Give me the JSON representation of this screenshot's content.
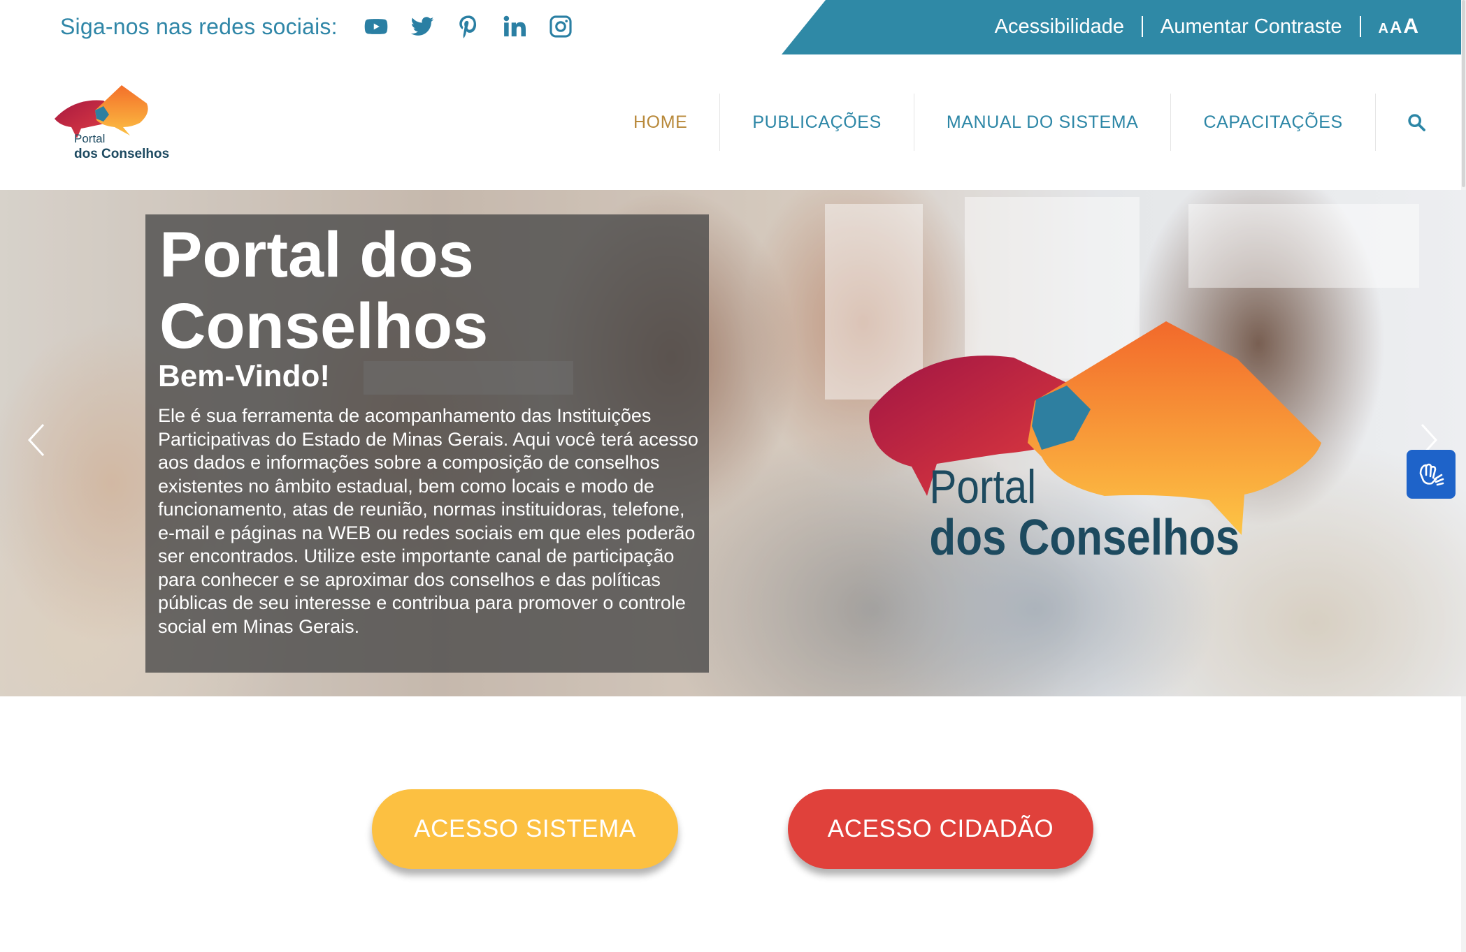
{
  "topbar": {
    "social_label": "Siga-nos nas redes sociais:",
    "social_icons": [
      "youtube-icon",
      "twitter-icon",
      "pinterest-icon",
      "linkedin-icon",
      "instagram-icon"
    ],
    "accessibility_label": "Acessibilidade",
    "contrast_label": "Aumentar Contraste",
    "font_size_labels": [
      "A",
      "A",
      "A"
    ],
    "bar_color": "#2f89a6"
  },
  "logo": {
    "line1": "Portal",
    "line2": "dos Conselhos"
  },
  "nav": {
    "items": [
      {
        "label": "HOME",
        "active": true
      },
      {
        "label": "PUBLICAÇÕES",
        "active": false
      },
      {
        "label": "MANUAL DO SISTEMA",
        "active": false
      },
      {
        "label": "CAPACITAÇÕES",
        "active": false
      }
    ],
    "search_icon": "search-icon",
    "active_color": "#b8893a",
    "link_color": "#2c86a6"
  },
  "hero": {
    "title": "Portal dos Conselhos",
    "subtitle": "Bem-Vindo!",
    "description": "Ele é sua ferramenta de acompanhamento das Instituições Participativas do Estado de Minas Gerais. Aqui você terá acesso aos dados e informações sobre a composição de conselhos existentes no âmbito estadual, bem como locais e modo de funcionamento, atas de reunião, normas instituidoras, telefone, e-mail e páginas na WEB ou redes sociais em que eles poderão ser encontrados. Utilize este importante canal de participação para conhecer e se aproximar dos conselhos e das políticas públicas de seu interesse e contribua para promover o controle social em Minas Gerais.",
    "logo_line1": "Portal",
    "logo_line2": "dos Conselhos",
    "prev_icon": "chevron-left-icon",
    "next_icon": "chevron-right-icon"
  },
  "widgets": {
    "libras_icon": "sign-language-hands-icon"
  },
  "buttons": {
    "sistema_label": "ACESSO SISTEMA",
    "cidadao_label": "ACESSO CIDADÃO",
    "sistema_color": "#fcc041",
    "cidadao_color": "#e0413b"
  }
}
